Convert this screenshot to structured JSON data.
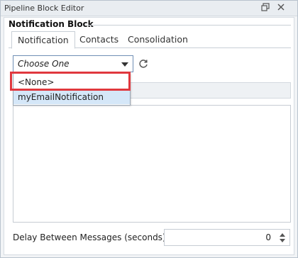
{
  "window": {
    "title": "Pipeline Block Editor",
    "restore_icon": "restore-icon",
    "close_icon": "close-icon"
  },
  "section": {
    "title": "Notification Block"
  },
  "tabs": [
    {
      "label": "Notification",
      "active": true
    },
    {
      "label": "Contacts",
      "active": false
    },
    {
      "label": "Consolidation",
      "active": false
    }
  ],
  "dropdown": {
    "selected": "Choose One",
    "options": [
      "<None>",
      "myEmailNotification"
    ],
    "highlighted_option": "myEmailNotification"
  },
  "refresh": {
    "icon": "refresh-icon"
  },
  "delay": {
    "label": "Delay Between Messages (seconds):",
    "value": "0"
  },
  "colors": {
    "highlight_border": "#e0383e",
    "selected_item_bg": "#d5e7f8",
    "dropdown_border": "#6f8fb5"
  }
}
